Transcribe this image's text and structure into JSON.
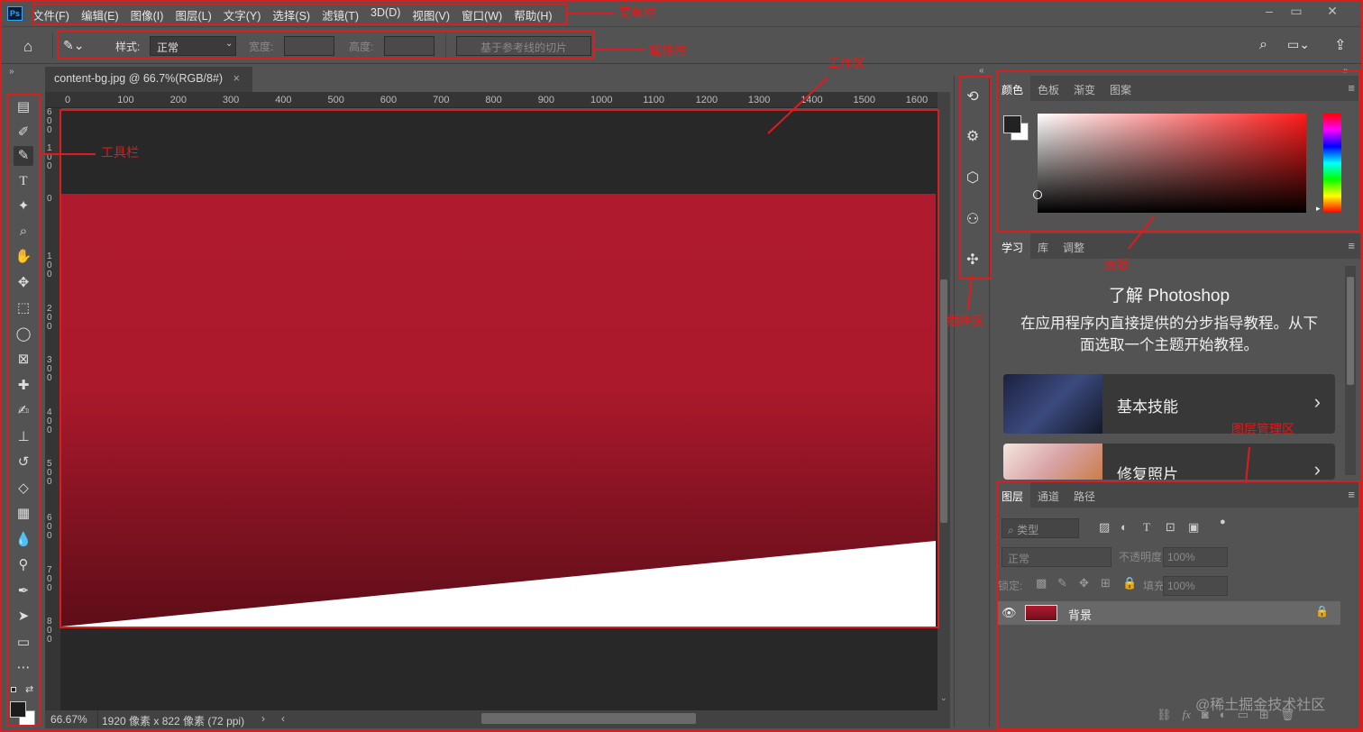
{
  "app": {
    "logo_text": "Ps",
    "menu": [
      "文件(F)",
      "编辑(E)",
      "图像(I)",
      "图层(L)",
      "文字(Y)",
      "选择(S)",
      "滤镜(T)",
      "3D(D)",
      "视图(V)",
      "窗口(W)",
      "帮助(H)"
    ],
    "window_controls": [
      "minimize-icon",
      "maximize-icon",
      "close-icon"
    ]
  },
  "options_bar": {
    "style_label": "样式:",
    "style_value": "正常",
    "width_label": "宽度:",
    "height_label": "高度:",
    "slice_button": "基于参考线的切片"
  },
  "document": {
    "tab_title": "content-bg.jpg @ 66.7%(RGB/8#)",
    "ruler_h": [
      "0",
      "100",
      "200",
      "300",
      "400",
      "500",
      "600",
      "700",
      "800",
      "900",
      "1000",
      "1100",
      "1200",
      "1300",
      "1400",
      "1500",
      "1600"
    ],
    "ruler_v": [
      "6\n0\n0",
      "1\n0\n0",
      "0",
      "1\n0\n0",
      "2\n0\n0",
      "3\n0\n0",
      "4\n0\n0",
      "5\n0\n0",
      "6\n0\n0",
      "7\n0\n0",
      "8\n0\n0"
    ],
    "zoom": "66.67%",
    "dimensions": "1920 像素 x 822 像素 (72 ppi)",
    "accent_color": "#b01a2e"
  },
  "panels": {
    "color": {
      "tabs": [
        "颜色",
        "色板",
        "渐变",
        "图案"
      ],
      "foreground": "#222222",
      "background": "#ffffff"
    },
    "learn": {
      "tabs": [
        "学习",
        "库",
        "调整"
      ],
      "title": "了解 Photoshop",
      "description": "在应用程序内直接提供的分步指导教程。从下面选取一个主题开始教程。",
      "cards": [
        "基本技能",
        "修复照片"
      ]
    },
    "layers": {
      "tabs": [
        "图层",
        "通道",
        "路径"
      ],
      "filter_placeholder": "类型",
      "blend_mode": "正常",
      "opacity_label": "不透明度:",
      "opacity_value": "100%",
      "lock_label": "锁定:",
      "fill_label": "填充:",
      "fill_value": "100%",
      "layer_name": "背景",
      "footer_icons": [
        "link-icon",
        "fx-icon",
        "mask-icon",
        "adjustment-icon",
        "folder-icon",
        "new-layer-icon",
        "trash-icon"
      ]
    }
  },
  "annotations": {
    "menu_bar": "菜单栏",
    "options_bar": "属性栏",
    "work_area": "工作区",
    "toolbar": "工具栏",
    "panels": "面板",
    "plugins": "插件区",
    "layers_area": "图层管理区"
  },
  "watermark": "@稀土掘金技术社区"
}
